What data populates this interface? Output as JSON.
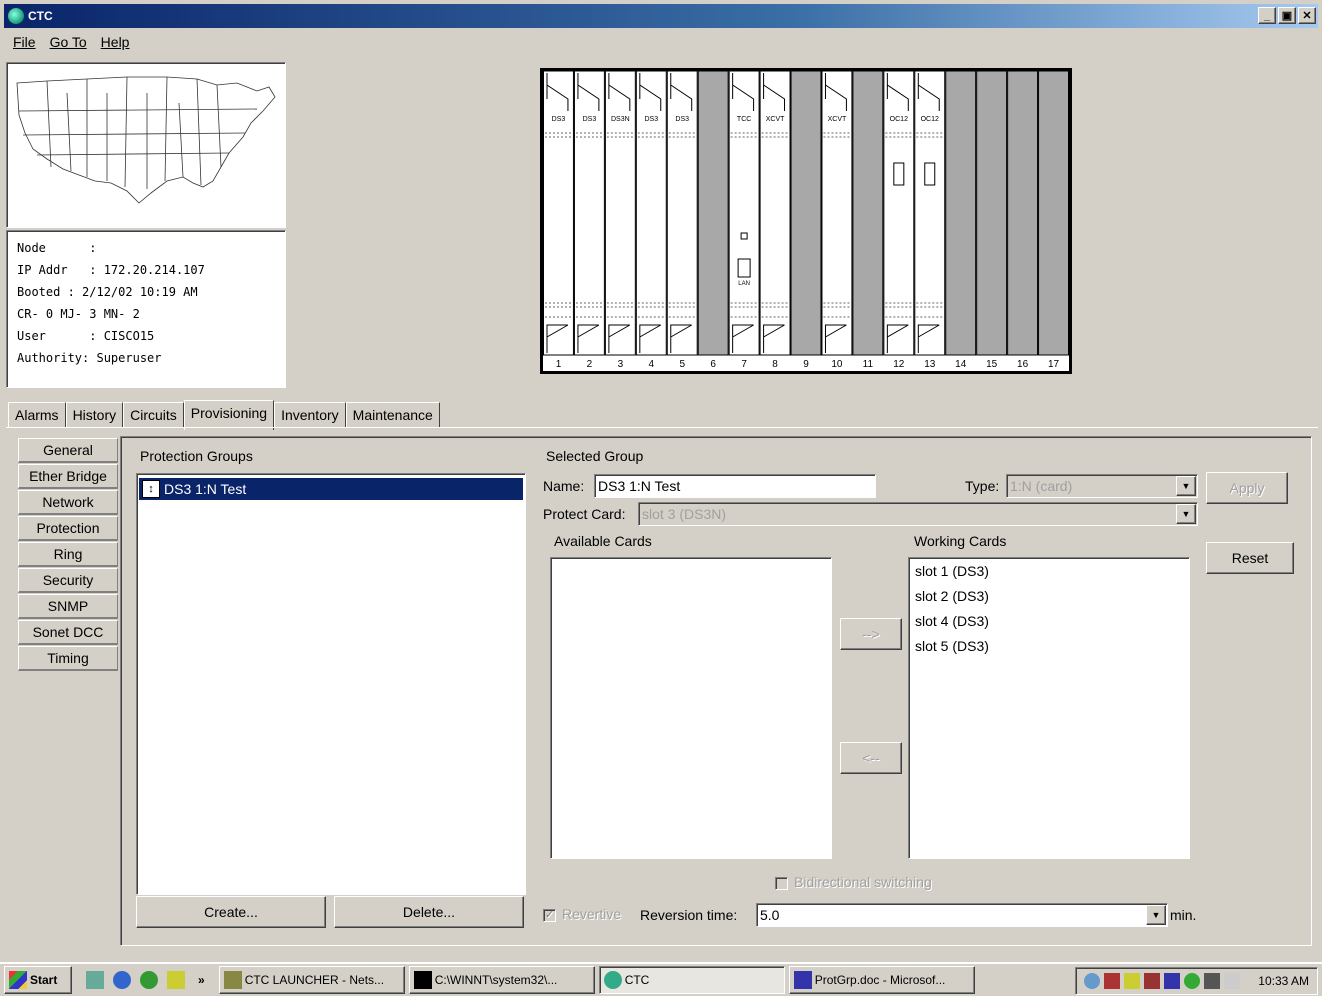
{
  "window": {
    "title": "CTC"
  },
  "menu": {
    "file": "File",
    "goto": "Go To",
    "help": "Help"
  },
  "node_info": {
    "lines": [
      "Node      :",
      "IP Addr   : 172.20.214.107",
      "Booted : 2/12/02 10:19 AM",
      "CR- 0 MJ- 3 MN- 2",
      "User      : CISCO15",
      "Authority: Superuser"
    ]
  },
  "shelf": {
    "slots": [
      {
        "num": "1",
        "label": "DS3",
        "card": true
      },
      {
        "num": "2",
        "label": "DS3",
        "card": true
      },
      {
        "num": "3",
        "label": "DS3N",
        "card": true
      },
      {
        "num": "4",
        "label": "DS3",
        "card": true
      },
      {
        "num": "5",
        "label": "DS3",
        "card": true
      },
      {
        "num": "6",
        "label": "",
        "card": false
      },
      {
        "num": "7",
        "label": "TCC",
        "card": true
      },
      {
        "num": "8",
        "label": "XCVT",
        "card": true
      },
      {
        "num": "9",
        "label": "",
        "card": false
      },
      {
        "num": "10",
        "label": "XCVT",
        "card": true
      },
      {
        "num": "11",
        "label": "",
        "card": false
      },
      {
        "num": "12",
        "label": "OC12",
        "card": true
      },
      {
        "num": "13",
        "label": "OC12",
        "card": true
      },
      {
        "num": "14",
        "label": "",
        "card": false
      },
      {
        "num": "15",
        "label": "",
        "card": false
      },
      {
        "num": "16",
        "label": "",
        "card": false
      },
      {
        "num": "17",
        "label": "",
        "card": false
      }
    ],
    "lan_label": "LAN"
  },
  "tabs": [
    "Alarms",
    "History",
    "Circuits",
    "Provisioning",
    "Inventory",
    "Maintenance"
  ],
  "active_tab": "Provisioning",
  "side_nav": [
    "General",
    "Ether Bridge",
    "Network",
    "Protection",
    "Ring",
    "Security",
    "SNMP",
    "Sonet DCC",
    "Timing"
  ],
  "protection_groups": {
    "label": "Protection Groups",
    "items": [
      "DS3 1:N Test"
    ],
    "create_label": "Create...",
    "delete_label": "Delete..."
  },
  "selected_group": {
    "label": "Selected Group",
    "name_label": "Name:",
    "name_value": "DS3 1:N Test",
    "type_label": "Type:",
    "type_value": "1:N (card)",
    "apply_label": "Apply",
    "protect_card_label": "Protect Card:",
    "protect_card_value": "slot 3 (DS3N)",
    "available_cards_label": "Available Cards",
    "working_cards_label": "Working Cards",
    "working_cards": [
      "slot  1 (DS3)",
      "slot  2 (DS3)",
      "slot  4 (DS3)",
      "slot  5 (DS3)"
    ],
    "move_right_label": "-->",
    "move_left_label": "<--",
    "reset_label": "Reset",
    "bidirectional_label": "Bidirectional switching",
    "revertive_label": "Revertive",
    "reversion_time_label": "Reversion time:",
    "reversion_time_value": "5.0",
    "min_label": "min."
  },
  "taskbar": {
    "start": "Start",
    "chevron": "»",
    "tasks": [
      "CTC LAUNCHER - Nets...",
      "C:\\WINNT\\system32\\...",
      "CTC",
      "ProtGrp.doc - Microsof..."
    ],
    "clock": "10:33 AM"
  }
}
